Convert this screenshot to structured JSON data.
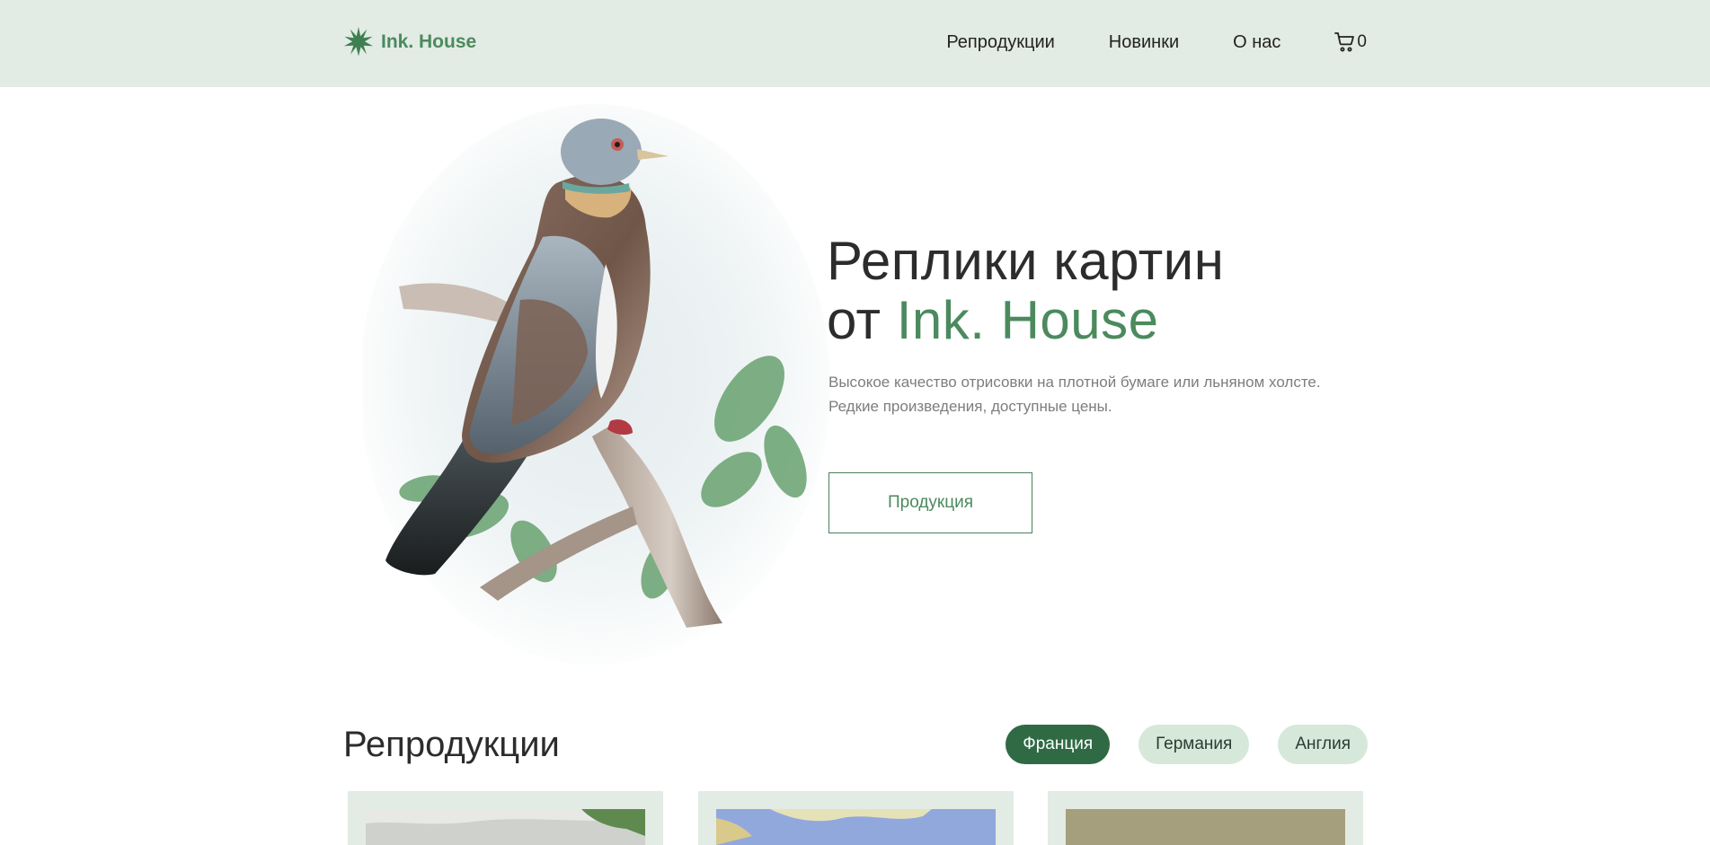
{
  "header": {
    "logo_text": "Ink. House",
    "nav": [
      {
        "label": "Репродукции"
      },
      {
        "label": "Новинки"
      },
      {
        "label": "О нас"
      }
    ],
    "cart_count": "0"
  },
  "hero": {
    "title_line1": "Реплики картин",
    "title_line2_prefix": "от ",
    "title_line2_accent": "Ink. House",
    "subtitle": "Высокое качество отрисовки на плотной бумаге или льняном холсте. Редкие произведения, доступные цены.",
    "button_label": "Продукция"
  },
  "reproductions": {
    "title": "Репродукции",
    "filters": [
      {
        "label": "Франция",
        "active": true
      },
      {
        "label": "Германия",
        "active": false
      },
      {
        "label": "Англия",
        "active": false
      }
    ]
  },
  "colors": {
    "header_bg": "#e2ebe4",
    "brand_green": "#4b8a5e",
    "chip_active": "#2f6a44",
    "chip_inactive": "#d5e8d9"
  },
  "icons": [
    "logo-star-icon",
    "cart-icon"
  ]
}
